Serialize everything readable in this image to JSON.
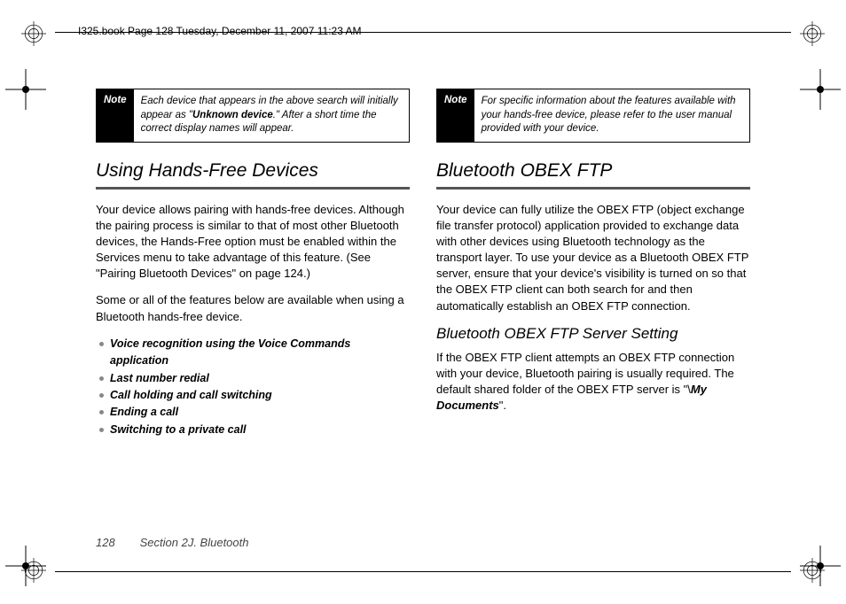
{
  "meta": {
    "headerInfo": "I325.book  Page 128  Tuesday, December 11, 2007  11:23 AM"
  },
  "left": {
    "note": {
      "label": "Note",
      "pre": "Each device that appears in the above search will initially appear as \"",
      "bold": "Unknown device",
      "post": ".\" After a short time the correct display names will appear."
    },
    "heading": "Using Hands-Free Devices",
    "para1": "Your device allows pairing with hands-free devices. Although the pairing process is similar to that of most other Bluetooth devices, the Hands-Free option must be enabled within the Services menu to take advantage of this feature. (See \"Pairing Bluetooth Devices\" on page 124.)",
    "para2": "Some or all of the features below are available when using a Bluetooth hands-free device.",
    "features": [
      "Voice recognition using the Voice Commands application",
      "Last number redial",
      "Call holding and call switching",
      "Ending a call",
      "Switching to a private call"
    ]
  },
  "right": {
    "note": {
      "label": "Note",
      "text": "For specific information about the features available with your hands-free device, please refer to the user manual provided with your device."
    },
    "heading": "Bluetooth OBEX FTP",
    "para1": "Your device can fully utilize the OBEX FTP (object exchange file transfer protocol) application provided to exchange data with other devices using Bluetooth technology as the transport layer. To use your device as a Bluetooth OBEX FTP server, ensure that your device's visibility is turned on so that the OBEX FTP client can both search for and then automatically establish an OBEX FTP connection.",
    "subheading": "Bluetooth OBEX FTP Server Setting",
    "para2_pre": "If the OBEX FTP client attempts an OBEX FTP connection with your device, Bluetooth pairing is usually required. The default shared folder of the OBEX FTP server is \"\\",
    "para2_bold": "My Documents",
    "para2_post": "\"."
  },
  "footer": {
    "pageNum": "128",
    "sectionLabel": "Section 2J. Bluetooth"
  }
}
